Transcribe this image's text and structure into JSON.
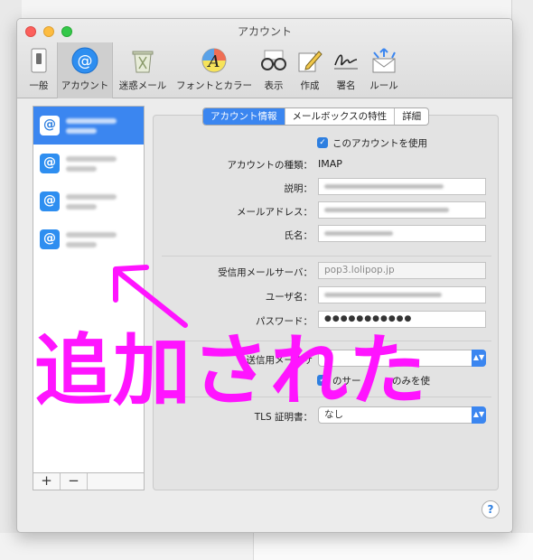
{
  "window": {
    "title": "アカウント"
  },
  "toolbar": {
    "items": [
      {
        "label": "一般",
        "icon": "general-switch-icon"
      },
      {
        "label": "アカウント",
        "icon": "at-sign-icon",
        "selected": true
      },
      {
        "label": "迷惑メール",
        "icon": "junk-trash-icon"
      },
      {
        "label": "フォントとカラー",
        "icon": "font-color-icon"
      },
      {
        "label": "表示",
        "icon": "glasses-icon"
      },
      {
        "label": "作成",
        "icon": "pencil-compose-icon"
      },
      {
        "label": "署名",
        "icon": "signature-icon"
      },
      {
        "label": "ルール",
        "icon": "rules-envelope-icon"
      }
    ]
  },
  "sidebar": {
    "accounts_count": 4,
    "add_label": "+",
    "remove_label": "−"
  },
  "tabs": [
    "アカウント情報",
    "メールボックスの特性",
    "詳細"
  ],
  "form": {
    "enable_account": "このアカウントを使用",
    "account_type_label": "アカウントの種類：",
    "account_type_value": "IMAP",
    "description_label": "説明：",
    "email_label": "メールアドレス：",
    "fullname_label": "氏名：",
    "incoming_server_label": "受信用メールサーバ：",
    "incoming_server_value": "pop3.lolipop.jp",
    "username_label": "ユーザ名：",
    "password_label": "パスワード：",
    "password_value": "●●●●●●●●●●●",
    "outgoing_label_partial": "送信用メールサ",
    "outgoing_only_partial": "のサー",
    "outgoing_only_suffix": "のみを使",
    "tls_label": "TLS 証明書：",
    "tls_value": "なし"
  },
  "overlay": {
    "text": "追加された",
    "color": "#ff14ff"
  },
  "help_label": "?"
}
